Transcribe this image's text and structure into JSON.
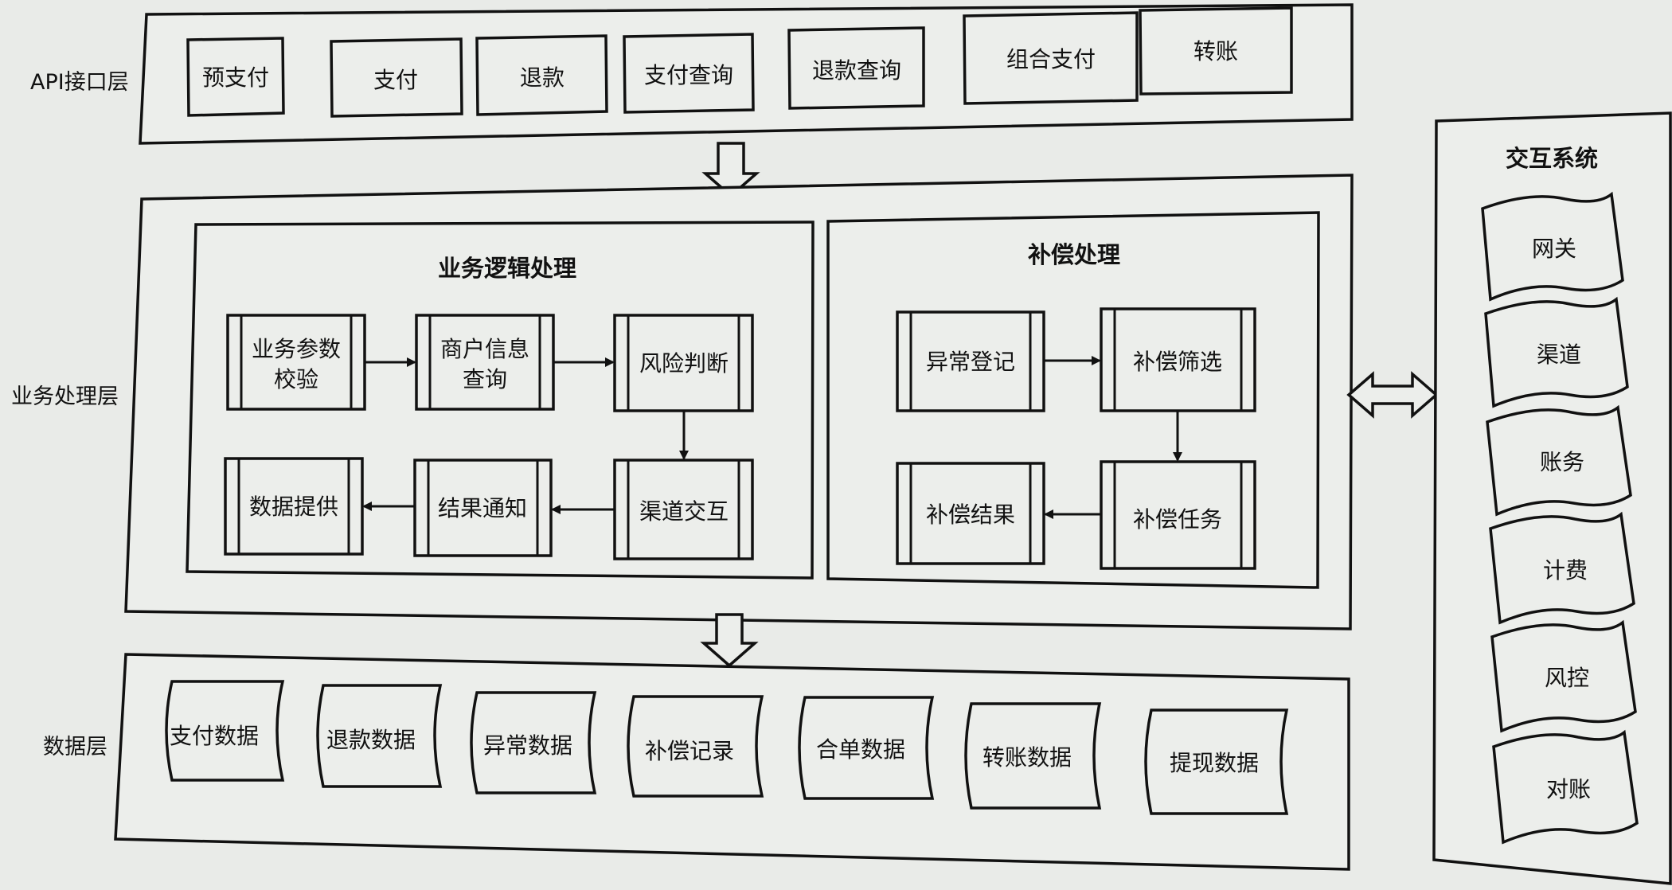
{
  "layers": {
    "api": "API接口层",
    "business": "业务处理层",
    "data": "数据层"
  },
  "api_items": [
    "预支付",
    "支付",
    "退款",
    "支付查询",
    "退款查询",
    "组合支付",
    "转账"
  ],
  "business_logic": {
    "title": "业务逻辑处理",
    "steps": [
      "业务参数",
      "校验",
      "商户信息",
      "查询",
      "风险判断",
      "渠道交互",
      "结果通知",
      "数据提供"
    ]
  },
  "compensation": {
    "title": "补偿处理",
    "steps": [
      "异常登记",
      "补偿筛选",
      "补偿任务",
      "补偿结果"
    ]
  },
  "data_items": [
    "支付数据",
    "退款数据",
    "异常数据",
    "补偿记录",
    "合单数据",
    "转账数据",
    "提现数据"
  ],
  "interaction": {
    "title": "交互系统",
    "items": [
      "网关",
      "渠道",
      "账务",
      "计费",
      "风控",
      "对账"
    ]
  }
}
